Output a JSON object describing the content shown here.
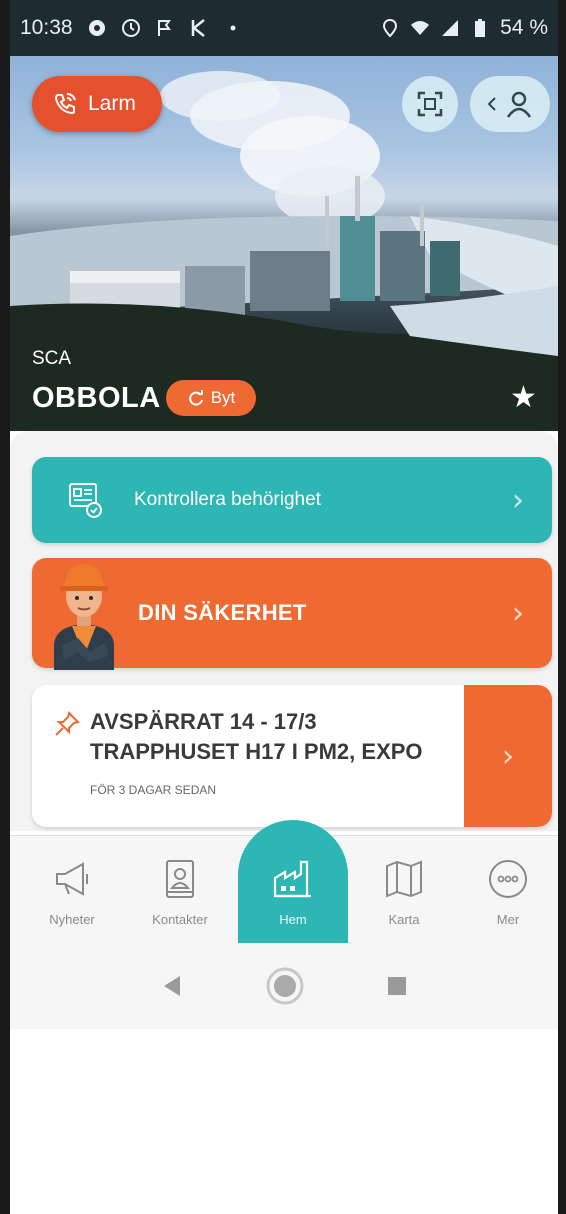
{
  "status_bar": {
    "time": "10:38",
    "battery": "54 %"
  },
  "hero": {
    "larm_label": "Larm",
    "company": "SCA",
    "site_name": "OBBOLA",
    "byt_label": "Byt"
  },
  "cards": {
    "access_label": "Kontrollera behörighet",
    "safety_label": "DIN SÄKERHET",
    "notice": {
      "title": "AVSPÄRRAT 14 - 17/3 TRAPPHUSET H17 I PM2, EXPO",
      "time": "FÖR 3 DAGAR SEDAN"
    }
  },
  "tabs": [
    {
      "label": "Nyheter",
      "icon": "megaphone-icon"
    },
    {
      "label": "Kontakter",
      "icon": "contacts-book-icon"
    },
    {
      "label": "Hem",
      "icon": "factory-icon"
    },
    {
      "label": "Karta",
      "icon": "map-icon"
    },
    {
      "label": "Mer",
      "icon": "more-dots-icon"
    }
  ],
  "colors": {
    "teal": "#2db6b3",
    "orange": "#ef6a33",
    "alarm_red": "#e5512f"
  }
}
